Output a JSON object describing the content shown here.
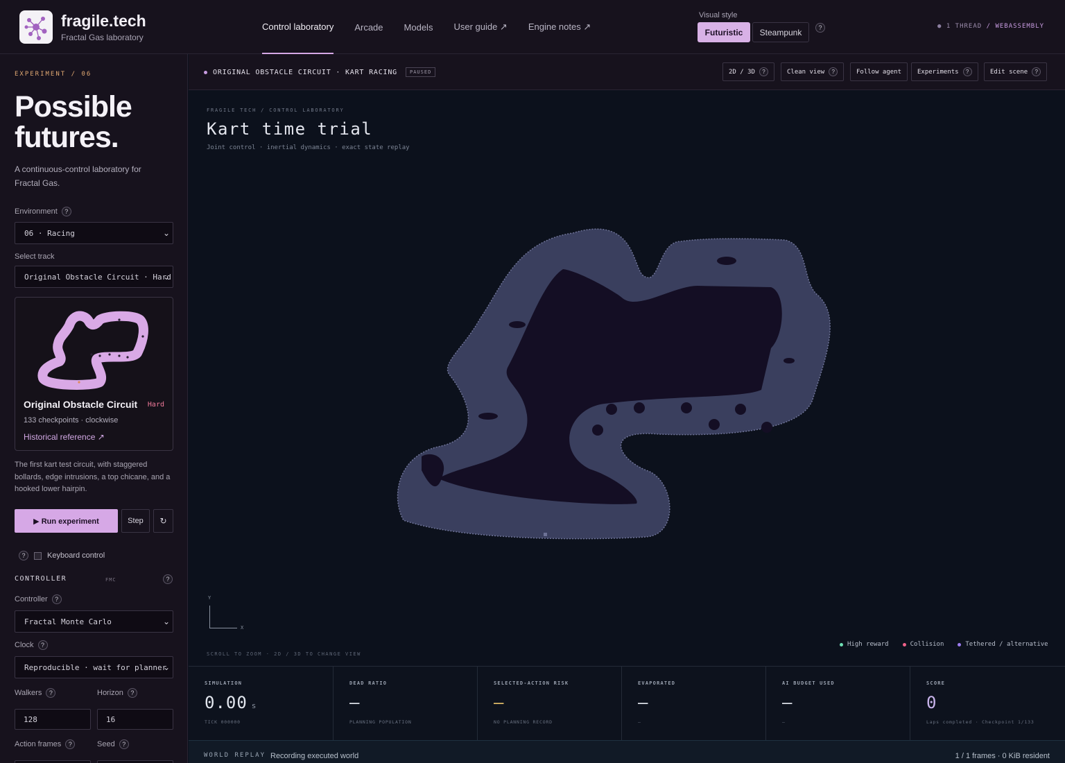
{
  "header": {
    "brand": "fragile.tech",
    "brand_sub": "Fractal Gas laboratory",
    "nav": [
      "Control laboratory",
      "Arcade",
      "Models",
      "User guide ↗",
      "Engine notes ↗"
    ],
    "visual_style_label": "Visual style",
    "style_options": [
      "Futuristic",
      "Steampunk"
    ],
    "selected_style": "Futuristic",
    "thread_count": "1 THREAD",
    "thread_engine": "/ WEBASSEMBLY"
  },
  "sidebar": {
    "kicker": "EXPERIMENT / 06",
    "headline": "Possible futures.",
    "intro": "A continuous-control laboratory for Fractal Gas.",
    "environment_label": "Environment",
    "environment_value": "06 · Racing",
    "track_label": "Select track",
    "track_value": "Original Obstacle Circuit · Hard",
    "track_card": {
      "name": "Original Obstacle Circuit",
      "difficulty": "Hard",
      "meta": "133 checkpoints · clockwise",
      "link": "Historical reference ↗"
    },
    "description": "The first kart test circuit, with staggered bollards, edge intrusions, a top chicane, and a hooked lower hairpin.",
    "run_label": "▶ Run experiment",
    "step_label": "Step",
    "reset_icon": "↻",
    "keyboard_label": "Keyboard control",
    "controller_heading": "CONTROLLER",
    "controller_tag": "FMC",
    "controller_label": "Controller",
    "controller_value": "Fractal Monte Carlo",
    "clock_label": "Clock",
    "clock_value": "Reproducible · wait for planner",
    "walkers_label": "Walkers",
    "walkers_value": "128",
    "horizon_label": "Horizon",
    "horizon_value": "16",
    "action_frames_label": "Action frames",
    "seed_label": "Seed"
  },
  "viewbar": {
    "title": "ORIGINAL OBSTACLE CIRCUIT · KART RACING",
    "status": "PAUSED",
    "tools": [
      "2D / 3D",
      "Clean view",
      "Follow agent",
      "Experiments",
      "Edit scene"
    ]
  },
  "view": {
    "kicker": "FRAGILE TECH / CONTROL LABORATORY",
    "title": "Kart time trial",
    "subtitle": "Joint control · inertial dynamics · exact state replay",
    "axis_y": "Y",
    "axis_x": "X",
    "hint": "SCROLL TO ZOOM · 2D / 3D TO CHANGE VIEW",
    "legend": [
      {
        "label": "High reward",
        "color": "#6fe0b4"
      },
      {
        "label": "Collision",
        "color": "#f0628a"
      },
      {
        "label": "Tethered / alternative",
        "color": "#9d7cf0"
      }
    ]
  },
  "metrics": [
    {
      "label": "SIMULATION",
      "value": "0.00",
      "unit": "s",
      "sub": "TICK 000000",
      "color": "#e2e6ee"
    },
    {
      "label": "DEAD RATIO",
      "value": "—",
      "unit": "",
      "sub": "PLANNING POPULATION",
      "color": "#e2e6ee"
    },
    {
      "label": "SELECTED-ACTION RISK",
      "value": "—",
      "unit": "",
      "sub": "NO PLANNING RECORD",
      "color": "#e6c06a"
    },
    {
      "label": "EVAPORATED",
      "value": "—",
      "unit": "",
      "sub": "—",
      "color": "#e2e6ee"
    },
    {
      "label": "AI BUDGET USED",
      "value": "—",
      "unit": "",
      "sub": "—",
      "color": "#e2e6ee"
    },
    {
      "label": "SCORE",
      "value": "0",
      "unit": "",
      "sub": "Laps completed · Checkpoint 1/133",
      "color": "#c9b4ec"
    }
  ],
  "replay": {
    "label": "WORLD REPLAY",
    "text": "Recording executed world",
    "frames": "1 / 1 frames · 0 KiB resident"
  },
  "colors": {
    "accent": "#d6a8e6",
    "track": "#3a3f5e",
    "infield": "#140e24"
  }
}
